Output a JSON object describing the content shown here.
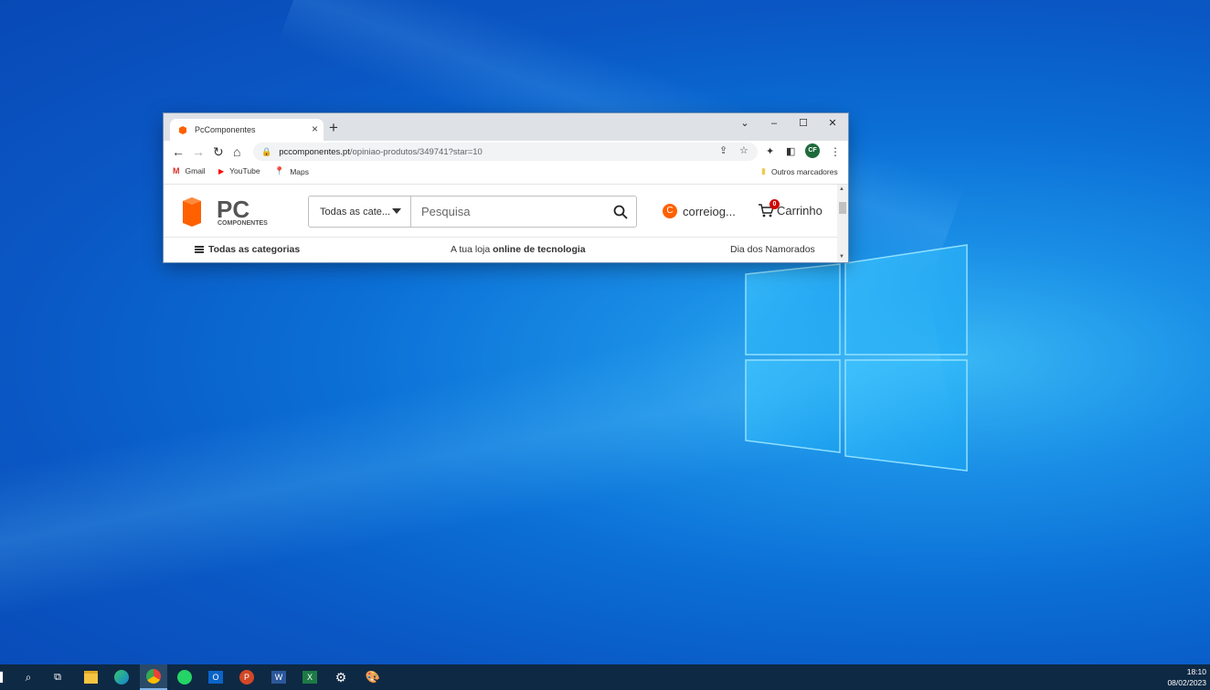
{
  "browser": {
    "tab_title": "PcComponentes",
    "tab_close_glyph": "×",
    "new_tab_glyph": "+",
    "url_domain": "pccomponentes.pt",
    "url_path": "/opiniao-produtos/349741?star=10",
    "profile_initials": "CF",
    "bookmarks": [
      {
        "label": "Gmail",
        "icon": "gmail-icon"
      },
      {
        "label": "YouTube",
        "icon": "youtube-icon"
      },
      {
        "label": "Maps",
        "icon": "maps-icon"
      }
    ],
    "other_bookmarks": "Outros marcadores"
  },
  "site": {
    "logo_text": "PC",
    "logo_sub": "COMPONENTES",
    "search_category": "Todas as cate...",
    "search_placeholder": "Pesquisa",
    "user_initial": "C",
    "user_label": "correiog...",
    "cart_count": "0",
    "cart_label": "Carrinho",
    "nav_all_categories": "Todas as categorias",
    "tagline_prefix": "A tua loja ",
    "tagline_bold": "online de tecnologia",
    "promo": "Dia dos Namorados",
    "brand_color": "#ff6000"
  },
  "taskbar": {
    "time": "18:10",
    "date": "08/02/2023",
    "apps": [
      "search-icon",
      "task-view-icon",
      "file-explorer-icon",
      "edge-icon",
      "chrome-icon",
      "whatsapp-icon",
      "outlook-icon",
      "powerpoint-icon",
      "word-icon",
      "excel-icon",
      "settings-icon",
      "paint-icon"
    ]
  }
}
